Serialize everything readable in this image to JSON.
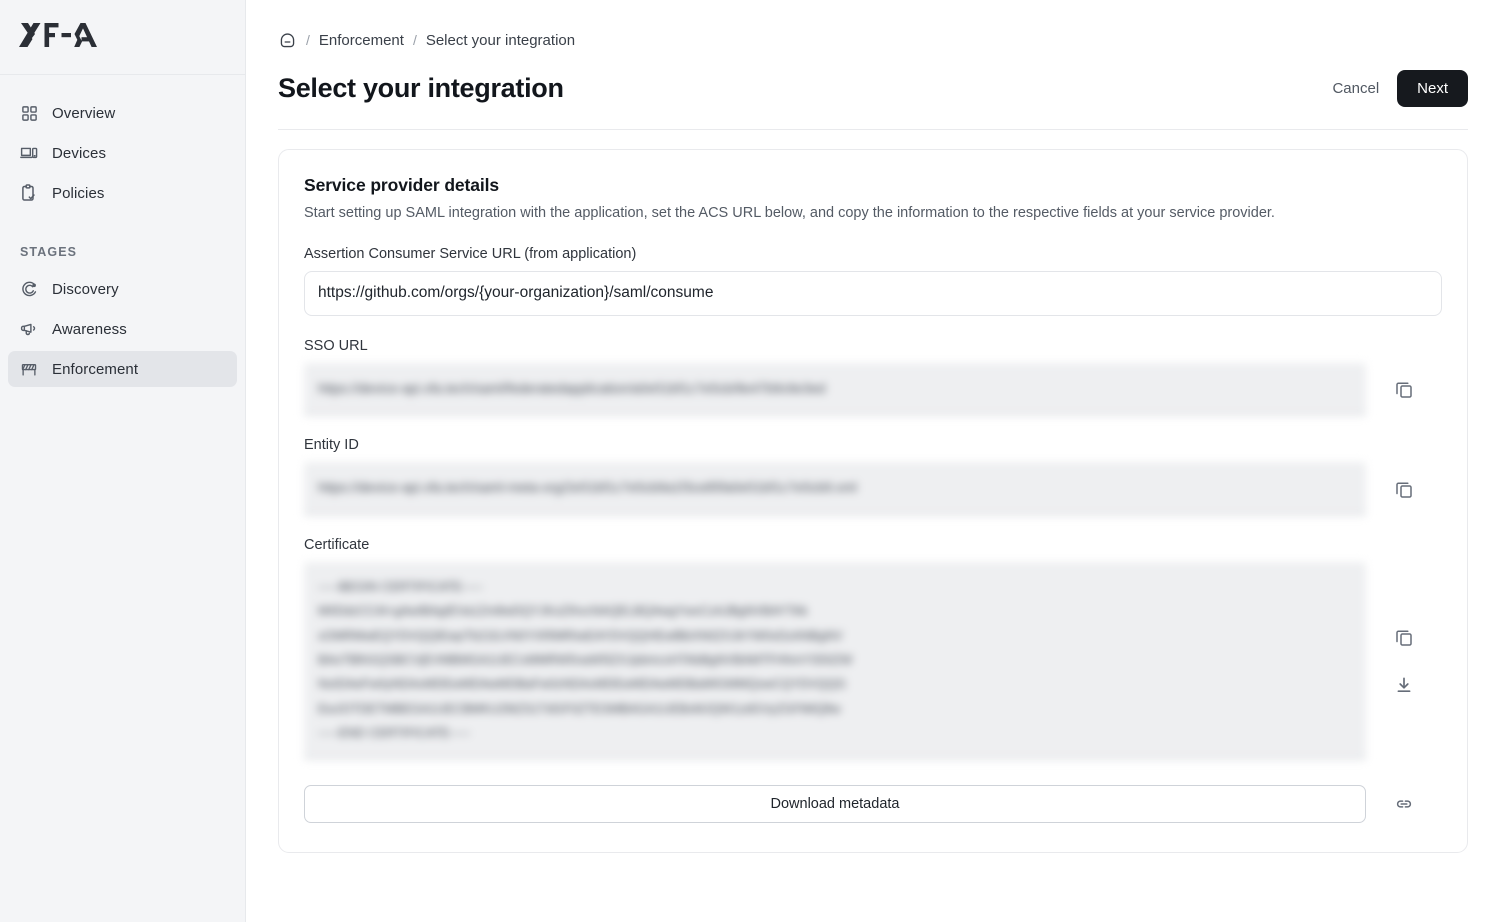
{
  "app": {
    "logo_text": "XFA"
  },
  "sidebar": {
    "items": [
      {
        "label": "Overview",
        "icon": "grid-icon",
        "active": false
      },
      {
        "label": "Devices",
        "icon": "devices-icon",
        "active": false
      },
      {
        "label": "Policies",
        "icon": "clipboard-check-icon",
        "active": false
      }
    ],
    "section_label": "STAGES",
    "stages": [
      {
        "label": "Discovery",
        "icon": "radar-icon",
        "active": false
      },
      {
        "label": "Awareness",
        "icon": "megaphone-icon",
        "active": false
      },
      {
        "label": "Enforcement",
        "icon": "barrier-icon",
        "active": true
      }
    ]
  },
  "breadcrumb": {
    "home_icon": "home-icon",
    "separator": "/",
    "items": [
      "Enforcement",
      "Select your integration"
    ]
  },
  "header": {
    "title": "Select your integration",
    "cancel_label": "Cancel",
    "next_label": "Next"
  },
  "card": {
    "title": "Service provider details",
    "subtitle": "Start setting up SAML integration with the application, set the ACS URL below, and copy the information to the respective fields at your service provider.",
    "acs": {
      "label": "Assertion Consumer Service URL (from application)",
      "value": "https://github.com/orgs/{your-organization}/saml/consume",
      "placeholder": "https://github.com/orgs/{your-organization}/saml/consume"
    },
    "sso": {
      "label": "SSO URL",
      "value": "https://device-api.xfa.tech/saml/federatedapplication/a0e51bf1c7e5cb/8e47b9c6e3ed",
      "copy_icon": "copy-icon"
    },
    "entity": {
      "label": "Entity ID",
      "value": "https://device-api.xfa.tech/saml-meta-org/2e51bf1c7e5cb9a1f3ce85fa0e51bf1c7e5cb9.xml",
      "copy_icon": "copy-icon"
    },
    "certificate": {
      "label": "Certificate",
      "value": "-----BEGIN CERTIFICATE-----\nMIIDdzCCAl+gAwIBAgIEVa1Zm8wDQYJKoZIhvcNAQELBQAwgYwxCzAJBgNVBAYTAk\nxOMRMwEQYDVQQIEwpTb21lLVN0YXRlMRIwEAYDVQQHEwlBbXN0ZXJkYW0xDzANBgNV\nBAoTBlhGQSBCVjEVMBMGA1UECxMMRW5naW5lZXJpbmcxHTAbBgNVBAMTFHhmYS50ZW\nNoIDAeFw0yNDAxMDEwMDAwMDBaFw0zNDAxMDEwMDAwMDBaMIGMMQswCQYDVQQG\nEwJOTDETMBEGA1UECBMKU29tZS1TdGF0ZTESMBAGA1UEBxMJQW1zdGVyZGFtMQ8w\n-----END CERTIFICATE-----",
      "copy_icon": "copy-icon",
      "download_icon": "download-icon"
    },
    "metadata": {
      "button_label": "Download metadata",
      "link_icon": "link-icon"
    }
  },
  "colors": {
    "accent_dark": "#16191e",
    "sidebar_bg": "#f4f5f7",
    "active_item_bg": "#e3e5e9",
    "readonly_bg": "#eeeff1",
    "border": "#e9eaed"
  }
}
